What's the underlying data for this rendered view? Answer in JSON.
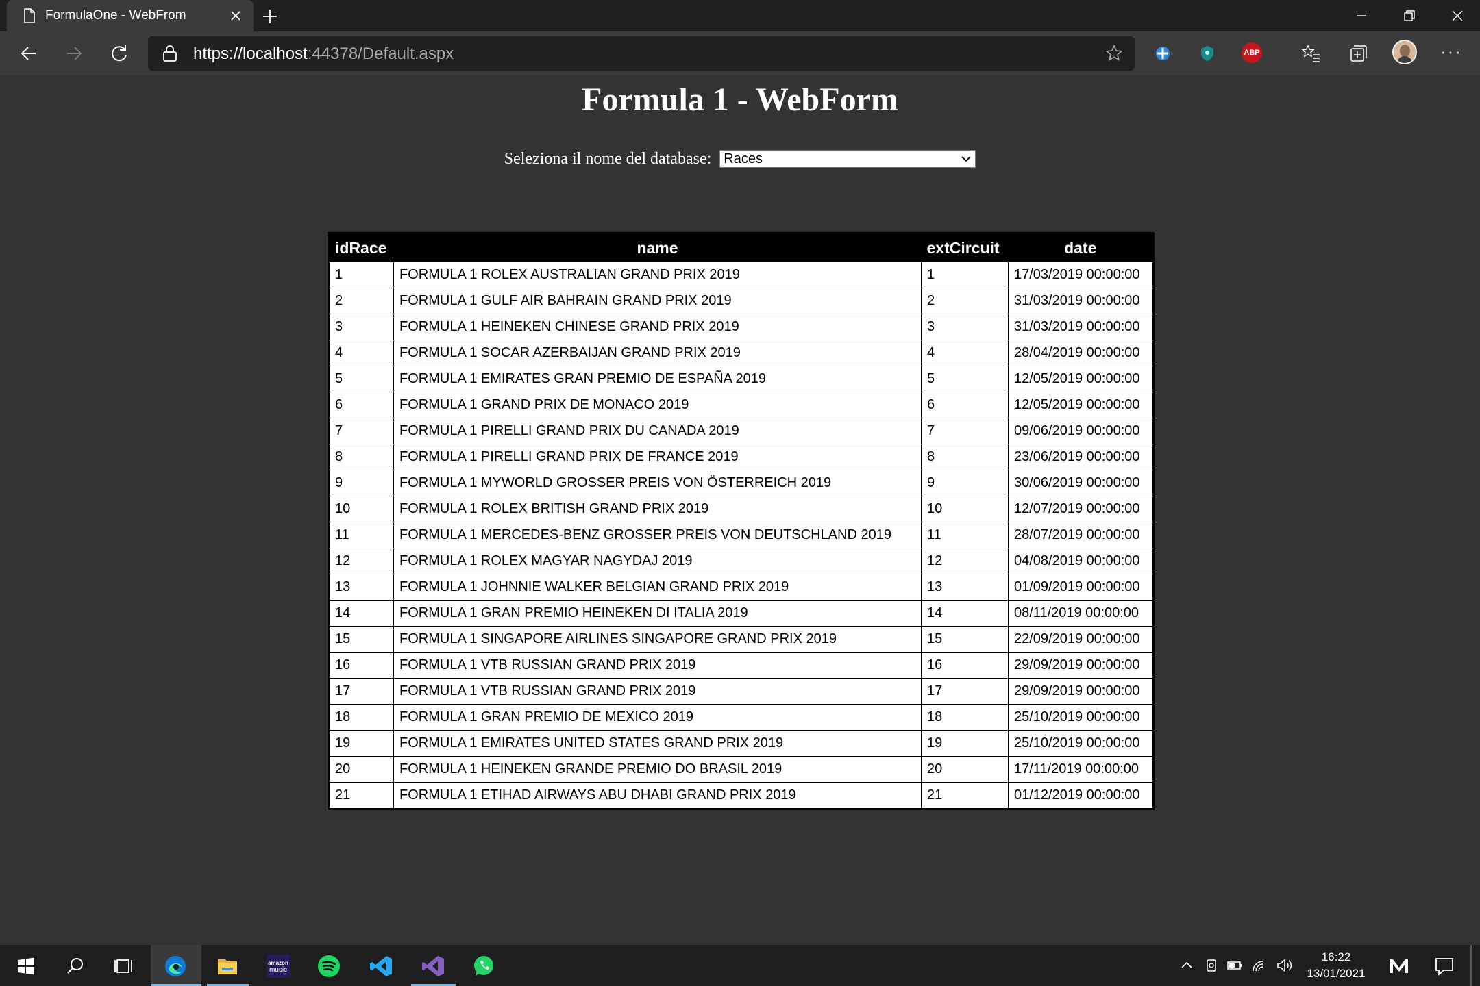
{
  "browser": {
    "tab_title": "FormulaOne - WebFrom",
    "url_host": "https://localhost",
    "url_path": ":44378/Default.aspx",
    "extensions": [
      "shield-extension-icon",
      "security-extension-icon",
      "adblock-plus-icon"
    ],
    "abp_label": "ABP"
  },
  "page": {
    "title": "Formula 1 - WebForm",
    "select_label": "Seleziona il nome del database:",
    "select_value": "Races"
  },
  "table": {
    "headers": [
      "idRace",
      "name",
      "extCircuit",
      "date"
    ],
    "rows": [
      [
        "1",
        "FORMULA 1 ROLEX AUSTRALIAN GRAND PRIX 2019",
        "1",
        "17/03/2019 00:00:00"
      ],
      [
        "2",
        "FORMULA 1 GULF AIR BAHRAIN GRAND PRIX 2019",
        "2",
        "31/03/2019 00:00:00"
      ],
      [
        "3",
        "FORMULA 1 HEINEKEN CHINESE GRAND PRIX 2019",
        "3",
        "31/03/2019 00:00:00"
      ],
      [
        "4",
        "FORMULA 1 SOCAR AZERBAIJAN GRAND PRIX 2019",
        "4",
        "28/04/2019 00:00:00"
      ],
      [
        "5",
        "FORMULA 1 EMIRATES GRAN PREMIO DE ESPAÑA 2019",
        "5",
        "12/05/2019 00:00:00"
      ],
      [
        "6",
        "FORMULA 1 GRAND PRIX DE MONACO 2019",
        "6",
        "12/05/2019 00:00:00"
      ],
      [
        "7",
        "FORMULA 1 PIRELLI GRAND PRIX DU CANADA 2019",
        "7",
        "09/06/2019 00:00:00"
      ],
      [
        "8",
        "FORMULA 1 PIRELLI GRAND PRIX DE FRANCE 2019",
        "8",
        "23/06/2019 00:00:00"
      ],
      [
        "9",
        "FORMULA 1 MYWORLD GROSSER PREIS VON ÖSTERREICH 2019",
        "9",
        "30/06/2019 00:00:00"
      ],
      [
        "10",
        "FORMULA 1 ROLEX BRITISH GRAND PRIX 2019",
        "10",
        "12/07/2019 00:00:00"
      ],
      [
        "11",
        "FORMULA 1 MERCEDES-BENZ GROSSER PREIS VON DEUTSCHLAND 2019",
        "11",
        "28/07/2019 00:00:00"
      ],
      [
        "12",
        "FORMULA 1 ROLEX MAGYAR NAGYDAJ 2019",
        "12",
        "04/08/2019 00:00:00"
      ],
      [
        "13",
        "FORMULA 1 JOHNNIE WALKER BELGIAN GRAND PRIX 2019",
        "13",
        "01/09/2019 00:00:00"
      ],
      [
        "14",
        "FORMULA 1 GRAN PREMIO HEINEKEN DI ITALIA 2019",
        "14",
        "08/11/2019 00:00:00"
      ],
      [
        "15",
        "FORMULA 1 SINGAPORE AIRLINES SINGAPORE GRAND PRIX 2019",
        "15",
        "22/09/2019 00:00:00"
      ],
      [
        "16",
        "FORMULA 1 VTB RUSSIAN GRAND PRIX 2019",
        "16",
        "29/09/2019 00:00:00"
      ],
      [
        "17",
        "FORMULA 1 VTB RUSSIAN GRAND PRIX 2019",
        "17",
        "29/09/2019 00:00:00"
      ],
      [
        "18",
        "FORMULA 1 GRAN PREMIO DE MEXICO 2019",
        "18",
        "25/10/2019 00:00:00"
      ],
      [
        "19",
        "FORMULA 1 EMIRATES UNITED STATES GRAND PRIX 2019",
        "19",
        "25/10/2019 00:00:00"
      ],
      [
        "20",
        "FORMULA 1 HEINEKEN GRANDE PREMIO DO BRASIL 2019",
        "20",
        "17/11/2019 00:00:00"
      ],
      [
        "21",
        "FORMULA 1 ETIHAD AIRWAYS ABU DHABI GRAND PRIX 2019",
        "21",
        "01/12/2019 00:00:00"
      ]
    ]
  },
  "taskbar": {
    "apps": [
      "windows-start-icon",
      "search-icon",
      "task-view-icon",
      "edge-icon",
      "file-explorer-icon",
      "amazon-music-icon",
      "spotify-icon",
      "vscode-icon",
      "visual-studio-icon",
      "whatsapp-icon"
    ],
    "amazon_music_label_1": "amazon",
    "amazon_music_label_2": "music",
    "time": "16:22",
    "date": "13/01/2021"
  },
  "colors": {
    "page_bg": "#333333",
    "table_header_bg": "#000000",
    "edge_blue": "#0f7bd8",
    "spotify_green": "#1ed760",
    "vs_purple": "#865fc5",
    "whatsapp_green": "#25d366"
  }
}
